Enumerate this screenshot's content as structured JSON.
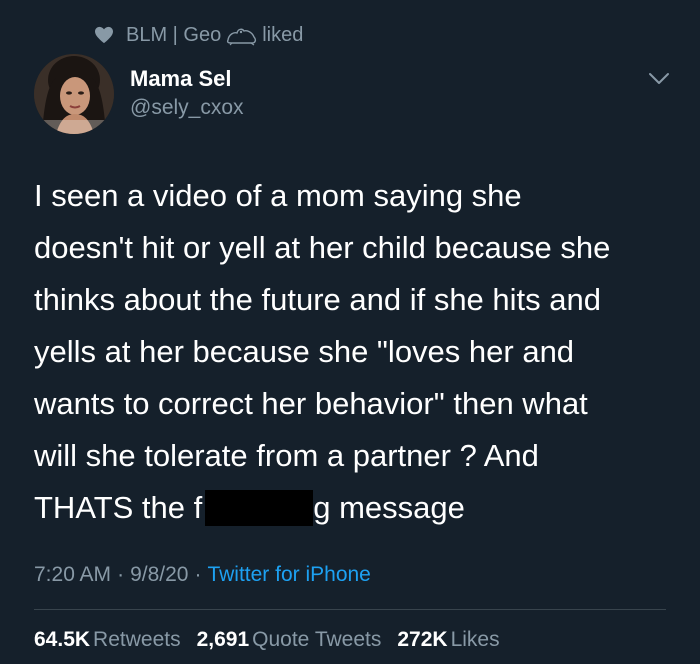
{
  "social_context": {
    "liker_name": "BLM | Geo",
    "liked_label": "liked"
  },
  "author": {
    "display_name": "Mama Sel",
    "handle": "@sely_cxox"
  },
  "tweet": {
    "lines": [
      "I seen a video of a mom saying she",
      "doesn't hit or yell at her child because she",
      "thinks about the future and if she hits and",
      "yells at her because she \"loves her and",
      "wants to correct her behavior\" then what",
      "will she tolerate from a partner ? And"
    ],
    "last_line_before": "THATS the f",
    "last_line_after": "g message"
  },
  "meta": {
    "time": "7:20 AM",
    "date": "9/8/20",
    "separator": "·",
    "source": "Twitter for iPhone"
  },
  "stats": {
    "retweets_count": "64.5K",
    "retweets_label": "Retweets",
    "quote_count": "2,691",
    "quote_label": "Quote Tweets",
    "likes_count": "272K",
    "likes_label": "Likes"
  },
  "icons": {
    "like": "heart-icon",
    "emoji": "frog-icon",
    "caret": "chevron-down-icon"
  },
  "colors": {
    "background": "#15202b",
    "secondary_text": "#8899a6",
    "link": "#1da1f2",
    "divider": "#38444d"
  }
}
